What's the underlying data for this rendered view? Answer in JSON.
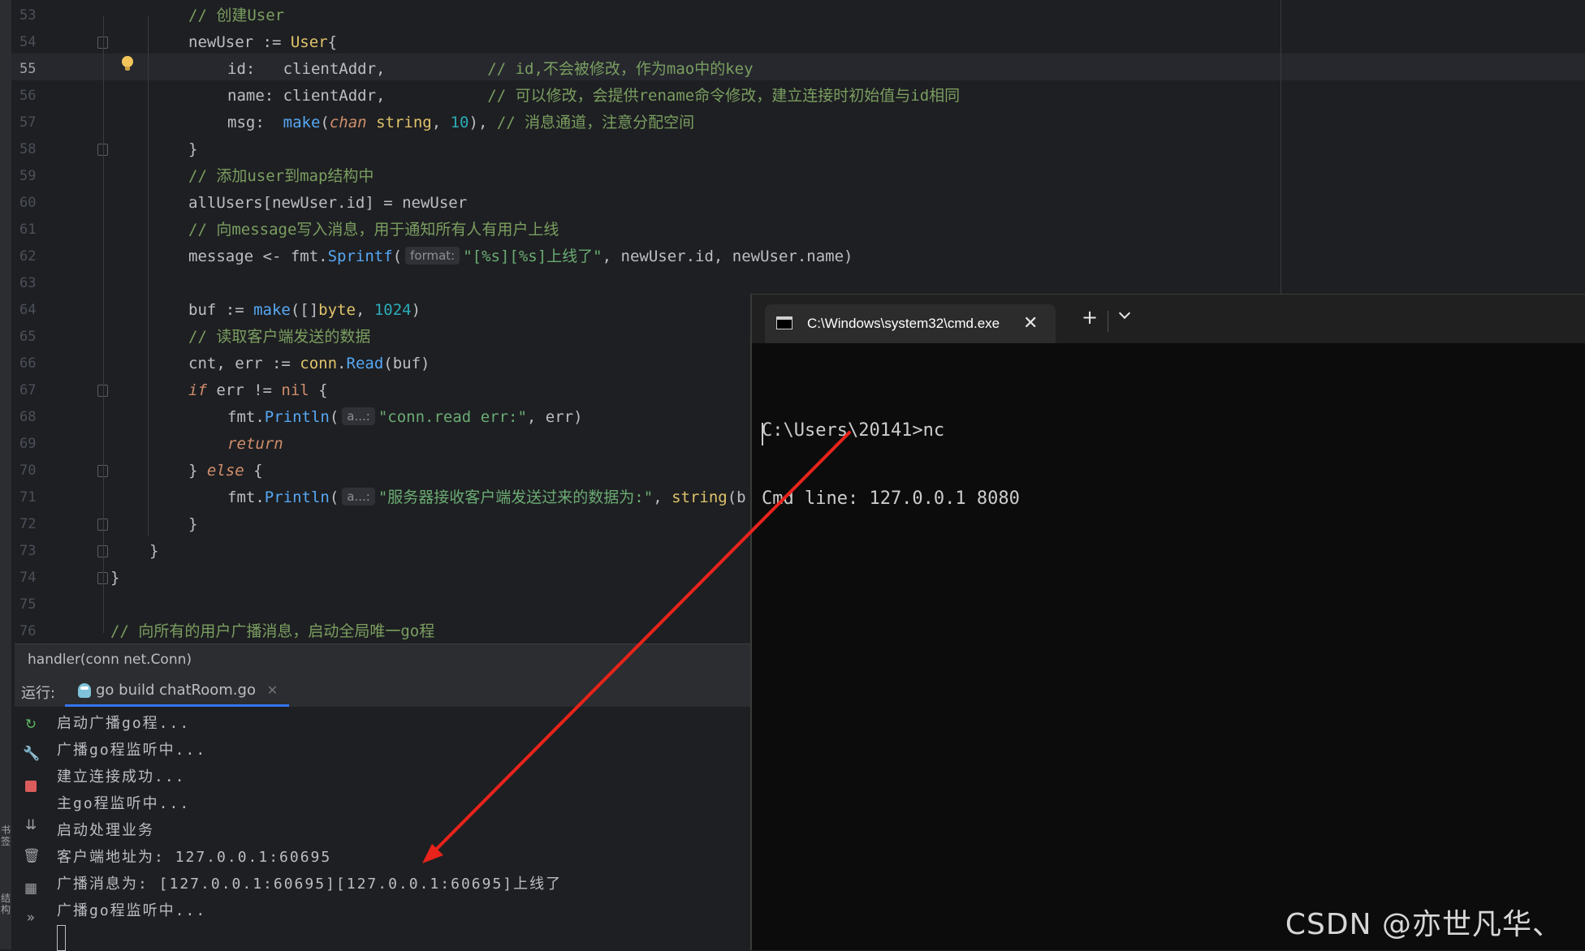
{
  "editor": {
    "lines": [
      {
        "n": "53",
        "segs": [
          {
            "c": "cm",
            "t": "// 创建User"
          }
        ]
      },
      {
        "n": "54",
        "segs": [
          {
            "c": "",
            "t": "newUser := "
          },
          {
            "c": "gt",
            "t": "User"
          },
          {
            "c": "",
            "t": "{"
          }
        ]
      },
      {
        "n": "55",
        "segs": [
          {
            "c": "",
            "t": "id:   clientAddr,           "
          },
          {
            "c": "cm",
            "t": "// id,不会被修改，作为mao中的key"
          }
        ]
      },
      {
        "n": "56",
        "segs": [
          {
            "c": "",
            "t": "name: clientAddr,           "
          },
          {
            "c": "cm",
            "t": "// 可以修改，会提供rename命令修改，建立连接时初始值与id相同"
          }
        ]
      },
      {
        "n": "57",
        "segs": [
          {
            "c": "",
            "t": "msg:  "
          },
          {
            "c": "fn",
            "t": "make"
          },
          {
            "c": "",
            "t": "("
          },
          {
            "c": "kwi",
            "t": "chan"
          },
          {
            "c": "",
            "t": " "
          },
          {
            "c": "gt",
            "t": "string"
          },
          {
            "c": "",
            "t": ", "
          },
          {
            "c": "num",
            "t": "10"
          },
          {
            "c": "",
            "t": "), "
          },
          {
            "c": "cm",
            "t": "// 消息通道，注意分配空间"
          }
        ]
      },
      {
        "n": "58",
        "segs": [
          {
            "c": "",
            "t": "}"
          }
        ]
      },
      {
        "n": "59",
        "segs": [
          {
            "c": "cm",
            "t": "// 添加user到map结构中"
          }
        ]
      },
      {
        "n": "60",
        "segs": [
          {
            "c": "",
            "t": "allUsers[newUser.id] = newUser"
          }
        ]
      },
      {
        "n": "61",
        "segs": [
          {
            "c": "cm",
            "t": "// 向message写入消息，用于通知所有人有用户上线"
          }
        ]
      },
      {
        "n": "62",
        "segs": [
          {
            "c": "",
            "t": "message <- fmt."
          },
          {
            "c": "fn",
            "t": "Sprintf"
          },
          {
            "c": "",
            "t": "("
          },
          {
            "c": "hint",
            "t": "format:"
          },
          {
            "c": "st",
            "t": "\"[%s][%s]上线了\""
          },
          {
            "c": "",
            "t": ", newUser.id, newUser.name)"
          }
        ]
      },
      {
        "n": "63",
        "segs": []
      },
      {
        "n": "64",
        "segs": [
          {
            "c": "",
            "t": "buf := "
          },
          {
            "c": "fn",
            "t": "make"
          },
          {
            "c": "",
            "t": "([]"
          },
          {
            "c": "gt",
            "t": "byte"
          },
          {
            "c": "",
            "t": ", "
          },
          {
            "c": "num",
            "t": "1024"
          },
          {
            "c": "",
            "t": ")"
          }
        ]
      },
      {
        "n": "65",
        "segs": [
          {
            "c": "cm",
            "t": "// 读取客户端发送的数据"
          }
        ]
      },
      {
        "n": "66",
        "segs": [
          {
            "c": "",
            "t": "cnt, err := "
          },
          {
            "c": "gt",
            "t": "conn"
          },
          {
            "c": "",
            "t": "."
          },
          {
            "c": "fn",
            "t": "Read"
          },
          {
            "c": "",
            "t": "(buf)"
          }
        ]
      },
      {
        "n": "67",
        "segs": [
          {
            "c": "kwi",
            "t": "if"
          },
          {
            "c": "",
            "t": " err != "
          },
          {
            "c": "kw",
            "t": "nil"
          },
          {
            "c": "",
            "t": " {"
          }
        ]
      },
      {
        "n": "68",
        "segs": [
          {
            "c": "",
            "t": "fmt."
          },
          {
            "c": "fn",
            "t": "Println"
          },
          {
            "c": "",
            "t": "("
          },
          {
            "c": "hint",
            "t": "a...:"
          },
          {
            "c": "st",
            "t": "\"conn.read err:\""
          },
          {
            "c": "",
            "t": ", err)"
          }
        ]
      },
      {
        "n": "69",
        "segs": [
          {
            "c": "kwi",
            "t": "return"
          }
        ]
      },
      {
        "n": "70",
        "segs": [
          {
            "c": "",
            "t": "} "
          },
          {
            "c": "kwi",
            "t": "else"
          },
          {
            "c": "",
            "t": " {"
          }
        ]
      },
      {
        "n": "71",
        "segs": [
          {
            "c": "",
            "t": "fmt."
          },
          {
            "c": "fn",
            "t": "Println"
          },
          {
            "c": "",
            "t": "("
          },
          {
            "c": "hint",
            "t": "a...:"
          },
          {
            "c": "st",
            "t": "\"服务器接收客户端发送过来的数据为:\""
          },
          {
            "c": "",
            "t": ", "
          },
          {
            "c": "gt",
            "t": "string"
          },
          {
            "c": "",
            "t": "(b"
          }
        ]
      },
      {
        "n": "72",
        "segs": [
          {
            "c": "",
            "t": "}"
          }
        ]
      },
      {
        "n": "73",
        "segs": [
          {
            "c": "",
            "t": "}"
          }
        ]
      },
      {
        "n": "74",
        "segs": [
          {
            "c": "",
            "t": "}"
          }
        ]
      },
      {
        "n": "75",
        "segs": []
      },
      {
        "n": "76",
        "segs": [
          {
            "c": "cm",
            "t": "// 向所有的用户广播消息，启动全局唯一go程"
          }
        ]
      }
    ]
  },
  "breadcrumb": "handler(conn net.Conn)",
  "run": {
    "label": "运行:",
    "tab": "go build chatRoom.go",
    "output": [
      "启动广播go程...",
      "广播go程监听中...",
      "建立连接成功...",
      "主go程监听中...",
      "启动处理业务",
      "客户端地址为: 127.0.0.1:60695",
      "广播消息为: [127.0.0.1:60695][127.0.0.1:60695]上线了",
      "广播go程监听中..."
    ]
  },
  "side_labels": [
    "书签",
    "结构"
  ],
  "terminal": {
    "title": "C:\\Windows\\system32\\cmd.exe",
    "lines": [
      "C:\\Users\\20141>nc",
      "Cmd line: 127.0.0.1 8080"
    ]
  },
  "watermark": "CSDN @亦世凡华、",
  "colors": {
    "arrow": "#e8231b",
    "accent": "#3574f0"
  }
}
